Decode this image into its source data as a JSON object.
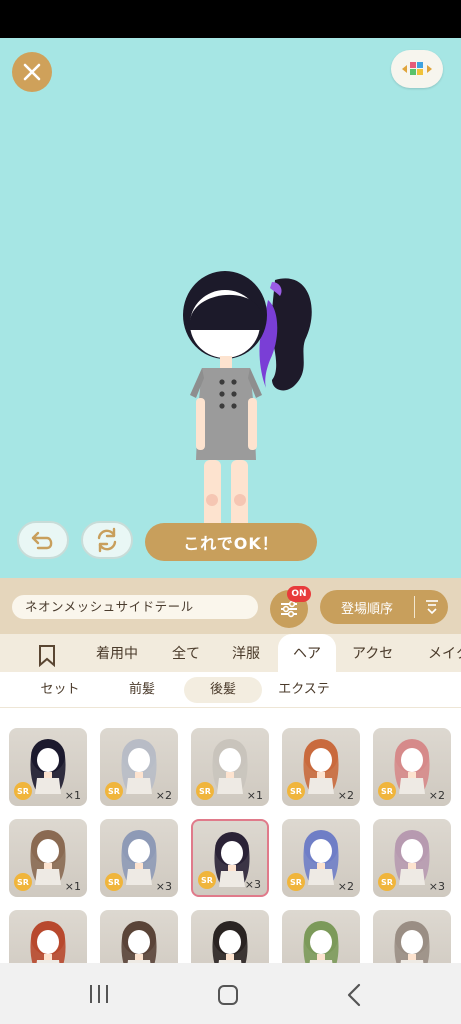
{
  "ok_button_label": "これでOK！",
  "hair_name": "ネオンメッシュサイドテール",
  "filter_badge": "ON",
  "sort_label": "登場順序",
  "category_tabs": [
    "着用中",
    "全て",
    "洋服",
    "ヘア",
    "アクセ",
    "メイク"
  ],
  "subtabs": [
    "セット",
    "前髪",
    "後髪",
    "エクステ"
  ],
  "items": [
    {
      "rarity": "SR",
      "count": "×1",
      "hair_color": "#1c1a2e"
    },
    {
      "rarity": "SR",
      "count": "×2",
      "hair_color": "#b8bcc6"
    },
    {
      "rarity": "SR",
      "count": "×1",
      "hair_color": "#c9c4bc"
    },
    {
      "rarity": "SR",
      "count": "×2",
      "hair_color": "#c96a3d"
    },
    {
      "rarity": "SR",
      "count": "×2",
      "hair_color": "#d68a8a"
    },
    {
      "rarity": "SR",
      "count": "×1",
      "hair_color": "#8a6a52"
    },
    {
      "rarity": "SR",
      "count": "×3",
      "hair_color": "#8e9ab6"
    },
    {
      "rarity": "SR",
      "count": "×3",
      "hair_color": "#2a2236"
    },
    {
      "rarity": "SR",
      "count": "×2",
      "hair_color": "#6f7ec6"
    },
    {
      "rarity": "SR",
      "count": "×3",
      "hair_color": "#b79ab0"
    },
    {
      "rarity": "",
      "count": "",
      "hair_color": "#b8492e"
    },
    {
      "rarity": "",
      "count": "",
      "hair_color": "#5a4438"
    },
    {
      "rarity": "",
      "count": "",
      "hair_color": "#2a2422"
    },
    {
      "rarity": "",
      "count": "",
      "hair_color": "#7c9a5a"
    },
    {
      "rarity": "",
      "count": "",
      "hair_color": "#9a8e84"
    }
  ]
}
